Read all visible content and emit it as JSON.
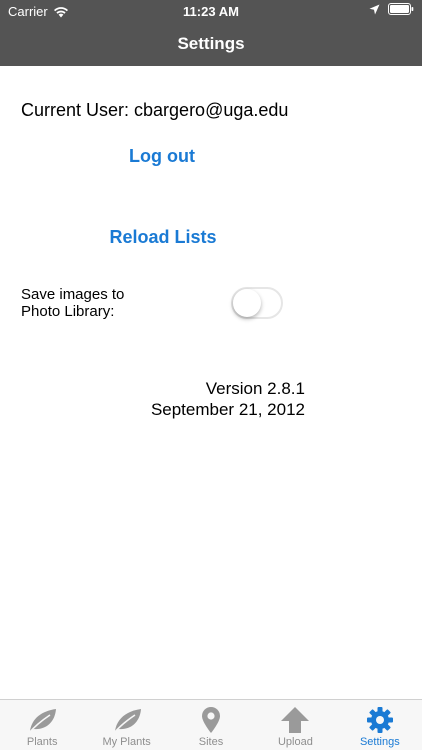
{
  "status_bar": {
    "carrier": "Carrier",
    "time": "11:23 AM"
  },
  "nav": {
    "title": "Settings"
  },
  "settings": {
    "current_user": "Current User: cbargero@uga.edu",
    "logout_label": "Log out",
    "reload_label": "Reload Lists",
    "save_images_label_line1": "Save images to",
    "save_images_label_line2": "Photo Library:",
    "save_images_enabled": false,
    "version_line1": "Version 2.8.1",
    "version_line2": "September 21, 2012"
  },
  "tabbar": {
    "tabs": [
      {
        "label": "Plants",
        "icon": "leaf-icon",
        "active": false
      },
      {
        "label": "My Plants",
        "icon": "leaf-icon",
        "active": false
      },
      {
        "label": "Sites",
        "icon": "map-pin-icon",
        "active": false
      },
      {
        "label": "Upload",
        "icon": "upload-arrow-icon",
        "active": false
      },
      {
        "label": "Settings",
        "icon": "gear-icon",
        "active": true
      }
    ]
  },
  "colors": {
    "header": "#545454",
    "accent": "#1a7ad4",
    "tab_inactive": "#8e8e8e",
    "tabbar_bg": "#f7f7f7"
  }
}
